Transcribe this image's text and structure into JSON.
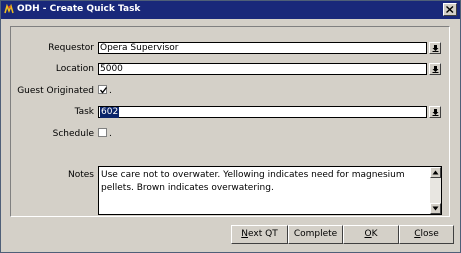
{
  "window": {
    "title": "ODH - Create Quick Task",
    "icon": "opera-app-icon"
  },
  "form": {
    "requestor": {
      "label": "Requestor",
      "value": "Opera Supervisor"
    },
    "location": {
      "label": "Location",
      "value": "5000"
    },
    "guest_originated": {
      "label": "Guest Originated",
      "checked": true,
      "suffix": "."
    },
    "task": {
      "label": "Task",
      "value": "602"
    },
    "schedule": {
      "label": "Schedule",
      "checked": false,
      "suffix": "."
    },
    "notes": {
      "label": "Notes",
      "value": "Use care not to overwater.  Yellowing indicates need for magnesium pellets. Brown indicates overwatering."
    }
  },
  "buttons": {
    "next_qt": {
      "first": "N",
      "rest": "ext QT"
    },
    "complete": {
      "label": "Complete"
    },
    "ok": {
      "first": "O",
      "rest": "K"
    },
    "close": {
      "first": "C",
      "rest": "lose"
    }
  }
}
